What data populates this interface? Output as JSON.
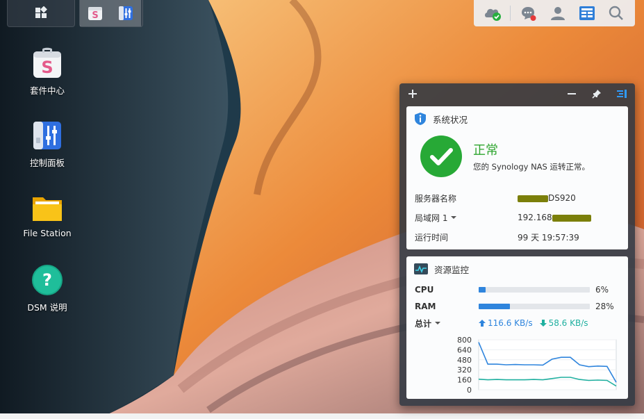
{
  "taskbar": {
    "main_menu_icon": "grid-icon",
    "apps": [
      {
        "name": "package-center-icon",
        "active": true
      },
      {
        "name": "control-panel-icon",
        "active": true
      }
    ]
  },
  "tray": {
    "icons": [
      "cloud-check-icon",
      "chat-notification-icon",
      "user-icon",
      "widgets-icon",
      "search-icon"
    ]
  },
  "desktop": {
    "icons": [
      {
        "label": "套件中心",
        "icon": "package-center-icon"
      },
      {
        "label": "控制面板",
        "icon": "control-panel-icon"
      },
      {
        "label": "File Station",
        "icon": "folder-icon"
      },
      {
        "label": "DSM 说明",
        "icon": "help-icon"
      }
    ]
  },
  "system_status": {
    "title": "系统状况",
    "status": "正常",
    "message": "您的 Synology NAS 运转正常。",
    "server_name_label": "服务器名称",
    "server_name_value": "DS920",
    "lan_label": "局域网 1",
    "lan_value": "192.168",
    "uptime_label": "运行时间",
    "uptime_value": "99 天 19:57:39"
  },
  "resource_monitor": {
    "title": "资源监控",
    "cpu_label": "CPU",
    "cpu_percent": "6%",
    "cpu_fraction": 0.06,
    "ram_label": "RAM",
    "ram_percent": "28%",
    "ram_fraction": 0.28,
    "network_label": "总计",
    "upload": "116.6 KB/s",
    "download": "58.6 KB/s",
    "colors": {
      "upload": "#2f85dd",
      "download": "#20b0a0"
    }
  },
  "chart_data": {
    "type": "line",
    "ylim": [
      0,
      800
    ],
    "yticks": [
      "800",
      "640",
      "480",
      "320",
      "160",
      "0"
    ],
    "series": [
      {
        "values": [
          760,
          410,
          410,
          400,
          405,
          400,
          400,
          395,
          490,
          520,
          520,
          400,
          370,
          380,
          375,
          120
        ]
      },
      {
        "values": [
          170,
          160,
          165,
          160,
          160,
          160,
          165,
          160,
          180,
          200,
          200,
          165,
          150,
          155,
          150,
          60
        ]
      }
    ]
  }
}
